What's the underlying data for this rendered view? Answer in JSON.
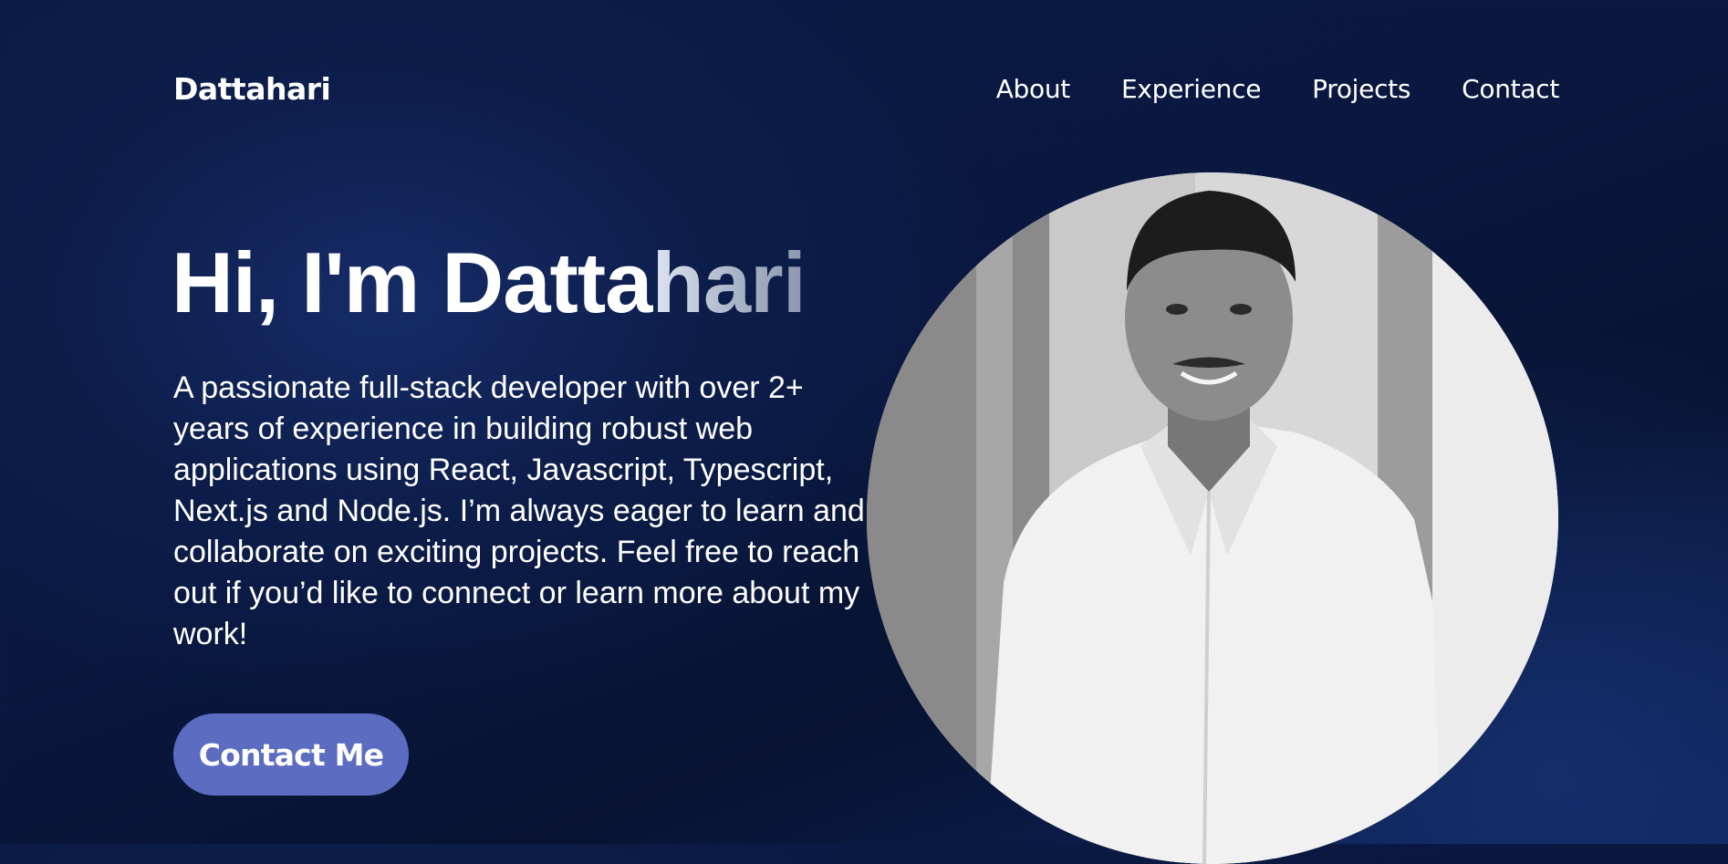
{
  "nav": {
    "brand": "Dattahari",
    "links": [
      {
        "label": "About"
      },
      {
        "label": "Experience"
      },
      {
        "label": "Projects"
      },
      {
        "label": "Contact"
      }
    ]
  },
  "hero": {
    "title_part1": "Hi, I'm Datta",
    "title_part2": "hari",
    "description": "A passionate full-stack developer with over 2+ years of experience in building robust web applications using React, Javascript, Typescript, Next.js and Node.js. I’m always eager to learn and collaborate on exciting projects. Feel free to reach out if you’d like to connect or learn more about my work!",
    "cta_label": "Contact Me"
  },
  "colors": {
    "background": "#0a1840",
    "accent_button": "#5b6cc1",
    "text": "#ffffff"
  }
}
